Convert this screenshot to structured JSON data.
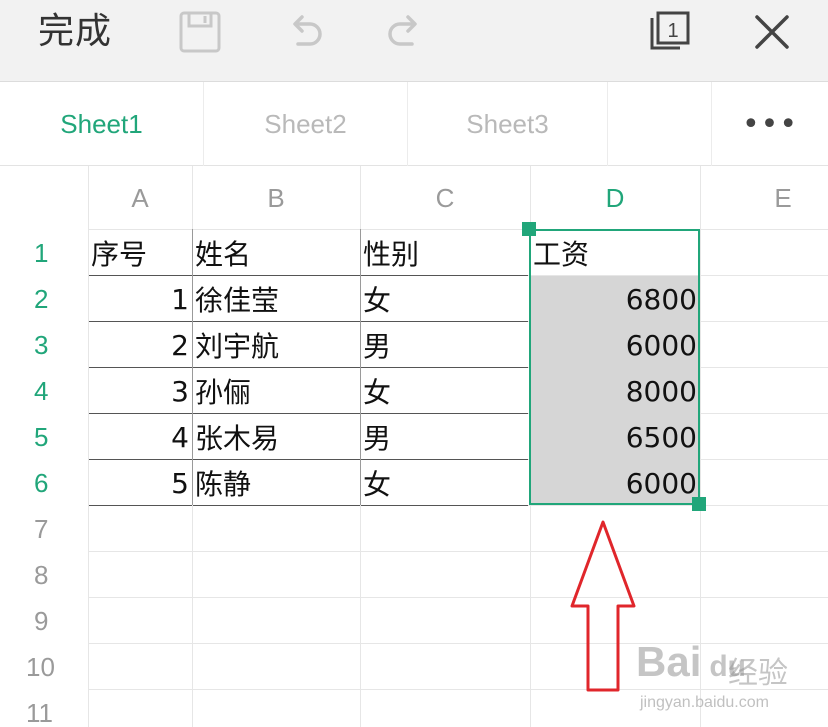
{
  "toolbar": {
    "done_label": "完成",
    "icons": [
      "save-icon",
      "undo-icon",
      "redo-icon",
      "page-switch-icon",
      "close-icon"
    ],
    "page_switch_count": "1"
  },
  "sheet_tabs": {
    "items": [
      {
        "label": "Sheet1",
        "active": true
      },
      {
        "label": "Sheet2",
        "active": false
      },
      {
        "label": "Sheet3",
        "active": false
      }
    ],
    "more_label": "•••"
  },
  "grid": {
    "columns": [
      "A",
      "B",
      "C",
      "D",
      "E"
    ],
    "active_column": "D",
    "row_numbers": [
      "1",
      "2",
      "3",
      "4",
      "5",
      "6",
      "7",
      "8",
      "9",
      "10",
      "11"
    ],
    "active_rows": [
      "1",
      "2",
      "3",
      "4",
      "5",
      "6"
    ],
    "header_row": [
      "序号",
      "姓名",
      "性别",
      "工资"
    ],
    "rows": [
      [
        "1",
        "徐佳莹",
        "女",
        "6800"
      ],
      [
        "2",
        "刘宇航",
        "男",
        "6000"
      ],
      [
        "3",
        "孙俪",
        "女",
        "8000"
      ],
      [
        "4",
        "张木易",
        "男",
        "6500"
      ],
      [
        "5",
        "陈静",
        "女",
        "6000"
      ]
    ],
    "selection": "D1:D6"
  },
  "colors": {
    "accent": "#21a67a",
    "selection_fill": "#d6d6d6",
    "annotation_arrow": "#e0262b"
  },
  "watermark": {
    "logo_text": "Bai",
    "logo_suffix": "du",
    "cn_text": "经验",
    "url": "jingyan.baidu.com"
  }
}
